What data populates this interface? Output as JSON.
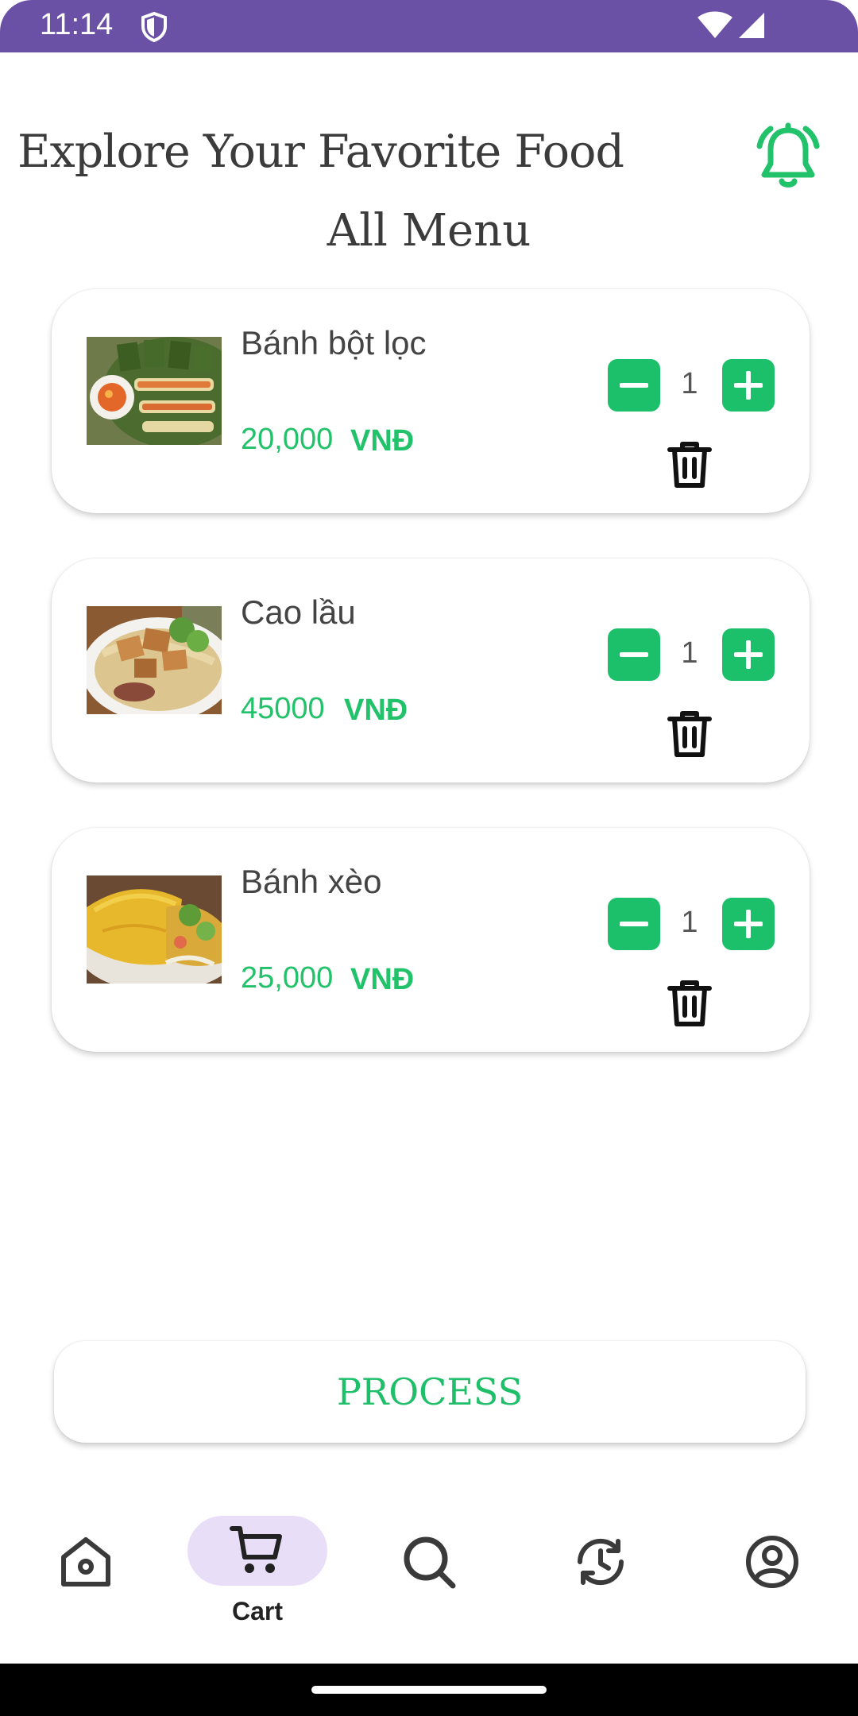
{
  "status_bar": {
    "time": "11:14"
  },
  "header": {
    "title": "Explore Your Favorite Food",
    "section_title": "All Menu"
  },
  "cart_items": [
    {
      "name": "Bánh bột lọc",
      "price": "20,000",
      "currency": "VNĐ",
      "quantity": "1"
    },
    {
      "name": "Cao lầu",
      "price": "45000",
      "currency": "VNĐ",
      "quantity": "1"
    },
    {
      "name": "Bánh xèo",
      "price": "25,000",
      "currency": "VNĐ",
      "quantity": "1"
    }
  ],
  "process_button": {
    "label": "PROCESS"
  },
  "bottom_nav": {
    "items": [
      {
        "icon": "home-icon"
      },
      {
        "icon": "cart-icon",
        "label": "Cart",
        "active": true
      },
      {
        "icon": "search-icon"
      },
      {
        "icon": "history-icon"
      },
      {
        "icon": "profile-icon"
      }
    ]
  },
  "colors": {
    "accent": "#1cc06a",
    "status_bar": "#6a51a6",
    "nav_pill": "#e9def8"
  }
}
